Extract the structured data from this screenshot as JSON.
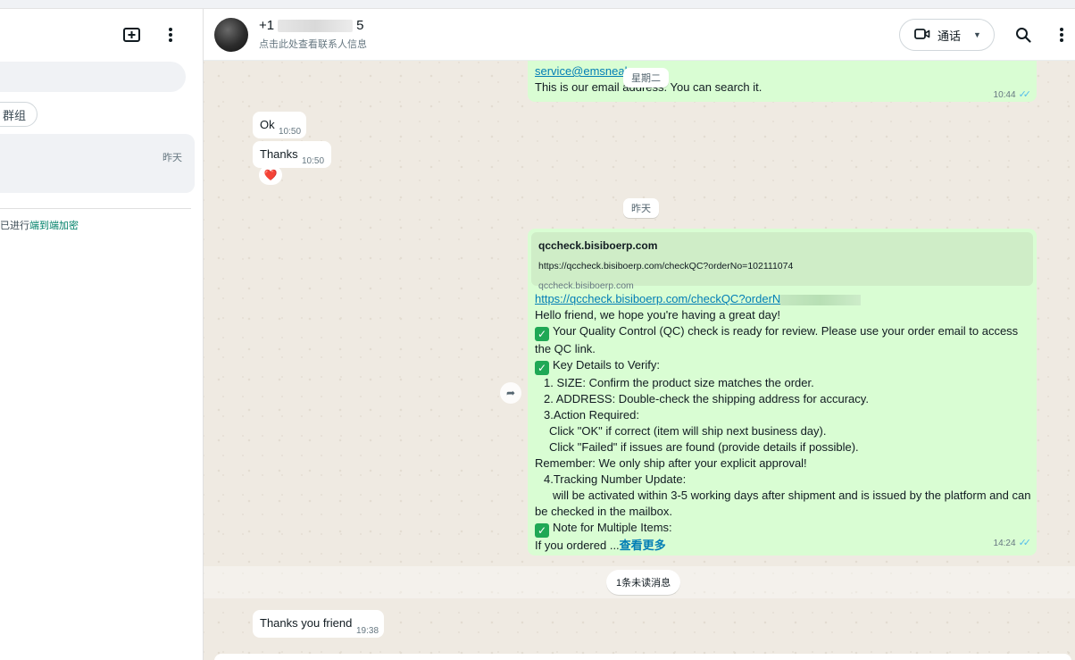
{
  "sidebar": {
    "new_chat_icon": "new-chat-icon",
    "menu_icon": "more-vertical-icon",
    "filter_chip": "群组",
    "chat_time": "昨天",
    "encryption_prefix": "已进行",
    "encryption_link": "端到端加密"
  },
  "header": {
    "contact_prefix": "+1",
    "contact_suffix": "5",
    "subtitle": "点击此处查看联系人信息",
    "call_label": "通话"
  },
  "messages": {
    "top_out_link": "service@emsneal",
    "top_out_text": "This is our email address. You can search it.",
    "top_out_time": "10:44",
    "day_tuesday": "星期二",
    "ok_text": "Ok",
    "ok_time": "10:50",
    "thanks_text": "Thanks",
    "thanks_time": "10:50",
    "reaction": "❤️",
    "day_yesterday": "昨天",
    "preview_title": "qccheck.bisiboerp.com",
    "preview_url": "https://qccheck.bisiboerp.com/checkQC?orderNo=102111074",
    "preview_domain": "qccheck.bisiboerp.com",
    "qc_link": "https://qccheck.bisiboerp.com/checkQC?orderN",
    "line_greeting": "Hello friend, we hope you're having a great day!",
    "line_ready": "Your Quality Control (QC) check is ready for review. Please use your order email to access the QC link.",
    "line_key": "Key Details to Verify:",
    "line_size": "1. SIZE: Confirm the product size matches the order.",
    "line_address": "2. ADDRESS: Double-check the shipping address for accuracy.",
    "line_action": "3.Action Required:",
    "line_ok": "Click \"OK\" if correct (item will ship next business day).",
    "line_failed": "Click \"Failed\" if issues are found (provide details if possible).",
    "line_remember": "Remember: We only ship after your explicit approval!",
    "line_tracking": "4.Tracking Number Update:",
    "line_activated": "will be activated within 3-5 working days after shipment and is issued by the platform and can be checked in the mailbox.",
    "line_note": "Note for Multiple Items:",
    "line_ordered": "If you ordered ...",
    "read_more": "查看更多",
    "qc_time": "14:24",
    "unread": "1条未读消息",
    "last_text": "Thanks you friend",
    "last_time": "19:38"
  },
  "colors": {
    "outgoing_bubble": "#d9fdd3",
    "chat_background": "#efeae2",
    "accent": "#008069",
    "link": "#027eb5",
    "read_ticks": "#53bdeb"
  }
}
